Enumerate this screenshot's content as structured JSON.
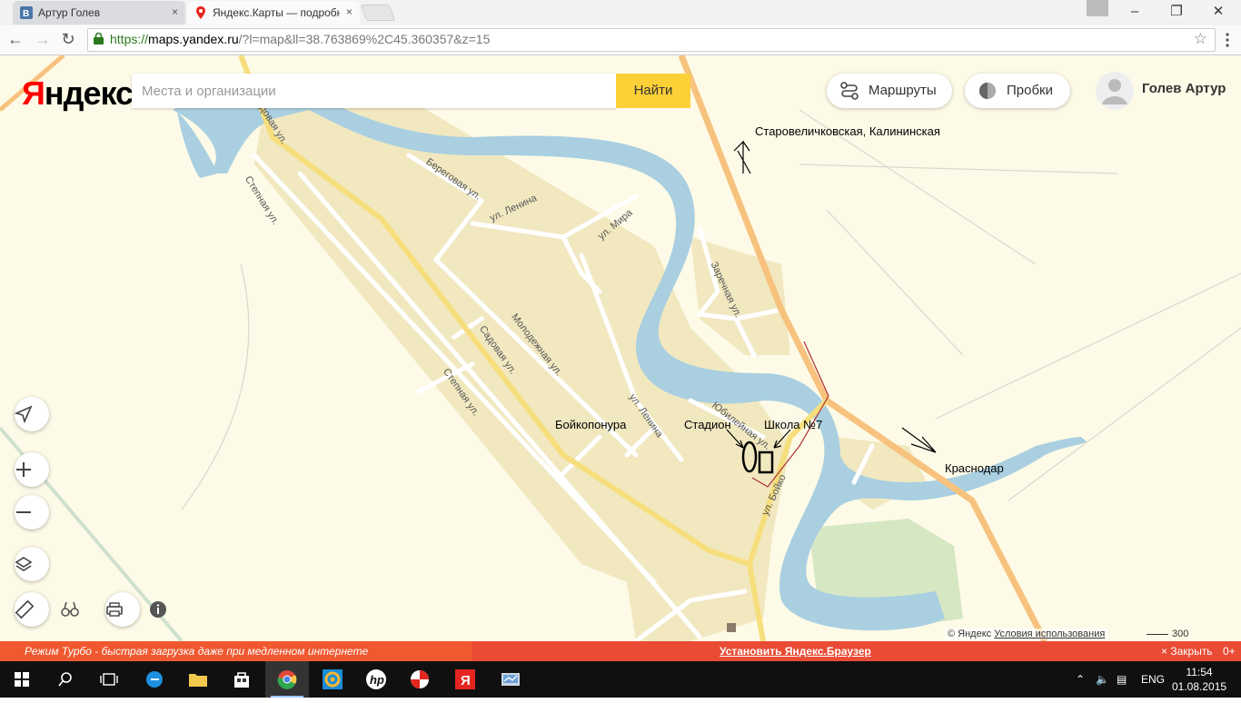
{
  "browser": {
    "tabs": [
      {
        "title": "Артур Голев",
        "favicon": "vk-icon"
      },
      {
        "title": "Яндекс.Карты — подробн",
        "favicon": "yandex-maps-pin-icon"
      }
    ],
    "tab_close": "×",
    "url_scheme": "https://",
    "url_host": "maps.yandex.ru",
    "url_rest": "/?l=map&ll=38.763869%2C45.360357&z=15",
    "window_controls": {
      "minimize": "–",
      "maximize": "❐",
      "close": "✕"
    }
  },
  "map_ui": {
    "logo_first": "Я",
    "logo_rest": "ндекс",
    "search_placeholder": "Места и организации",
    "search_button": "Найти",
    "routes_button": "Маршруты",
    "traffic_button": "Пробки",
    "user_name": "Голев Артур",
    "copyright": "© Яндекс",
    "terms": "Условия использования",
    "scale": "300 м"
  },
  "map_labels": {
    "village": "Бойкопонура",
    "stadium": "Стадион",
    "school": "Школа №7",
    "direction_north": "Старовеличковская, Калининская",
    "direction_east": "Краснодар"
  },
  "streets": {
    "stepnaya": "Степная ул.",
    "beregovaya": "Береговая ул.",
    "lenina": "ул. Ленина",
    "mira": "ул. Мира",
    "molodezhnaya": "Молодежная ул.",
    "sadovaya": "Садовая ул.",
    "zarechnaya": "Заречная ул.",
    "yubileynaya": "Юбилейная ул.",
    "boyko": "ул. Бойко",
    "sadovaya_partial": "довая ул."
  },
  "turbo_bar": {
    "left": "Режим Турбо - быстрая загрузка даже при медленном интернете",
    "center": "Установить Яндекс.Браузер",
    "close": "× Закрыть",
    "age": "0+"
  },
  "taskbar": {
    "lang": "ENG",
    "time": "11:54",
    "date": "01.08.2015"
  },
  "colors": {
    "map_bg": "#fdfbe7",
    "settlement": "#f1e8c0",
    "water": "#a9cfe0",
    "main_road": "#f7c27e",
    "yellow_road": "#f6de7c",
    "search_button": "#fcd037",
    "turbo": "#e94b35"
  }
}
